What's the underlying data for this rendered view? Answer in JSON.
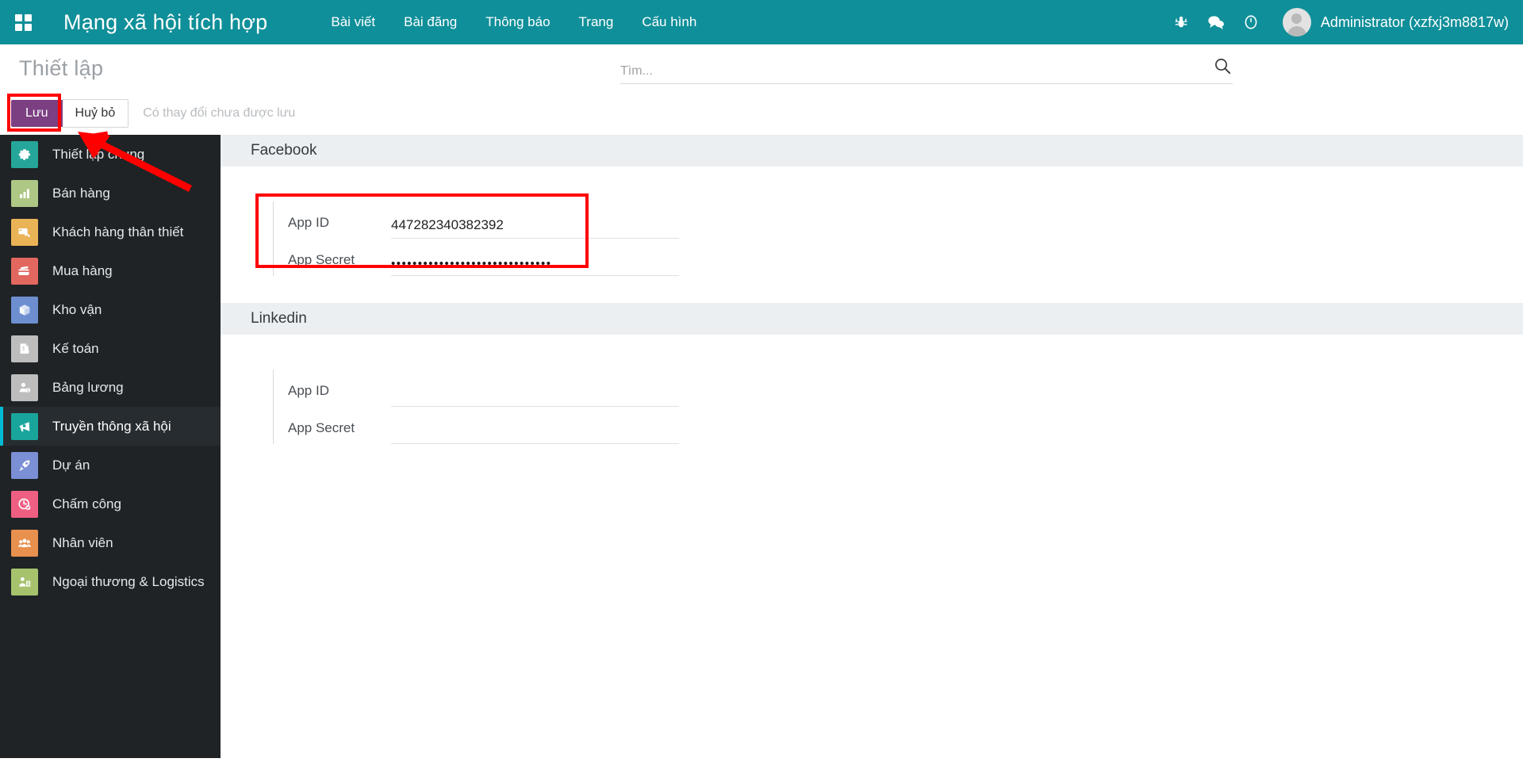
{
  "header": {
    "apps_icon": "apps-grid-icon",
    "brand": "Mạng xã hội tích hợp",
    "nav": [
      {
        "label": "Bài viết",
        "name": "nav-bai-viet"
      },
      {
        "label": "Bài đăng",
        "name": "nav-bai-dang"
      },
      {
        "label": "Thông báo",
        "name": "nav-thong-bao"
      },
      {
        "label": "Trang",
        "name": "nav-trang"
      },
      {
        "label": "Cấu hình",
        "name": "nav-cau-hinh"
      }
    ],
    "icons": [
      "bug-icon",
      "chat-bubble-icon",
      "clock-icon"
    ],
    "user": "Administrator (xzfxj3m8817w)",
    "accent": "#0f8f99"
  },
  "subheader": {
    "title": "Thiết lập",
    "search_placeholder": "Tìm...",
    "search_value": "",
    "search_icon": "search-icon"
  },
  "toolbar": {
    "save_label": "Lưu",
    "cancel_label": "Huỷ bỏ",
    "dirty_message": "Có thay đổi chưa được lưu",
    "save_color": "#7b3f82",
    "highlight_color": "#ff0000"
  },
  "sidebar": {
    "items": [
      {
        "label": "Thiết lập chung",
        "icon": "gear-icon",
        "color": "#26a69a",
        "active": false
      },
      {
        "label": "Bán hàng",
        "icon": "bar-chart-icon",
        "color": "#aec785",
        "active": false
      },
      {
        "label": "Khách hàng thân thiết",
        "icon": "loyalty-card-icon",
        "color": "#eab356",
        "active": false
      },
      {
        "label": "Mua hàng",
        "icon": "credit-card-icon",
        "color": "#e2685f",
        "active": false
      },
      {
        "label": "Kho vận",
        "icon": "box-icon",
        "color": "#6d8fd0",
        "active": false
      },
      {
        "label": "Kế toán",
        "icon": "invoice-icon",
        "color": "#bdbdbd",
        "active": false
      },
      {
        "label": "Bảng lương",
        "icon": "payroll-person-icon",
        "color": "#bdbdbd",
        "active": false
      },
      {
        "label": "Truyền thông xã hội",
        "icon": "megaphone-icon",
        "color": "#1aa59c",
        "active": true
      },
      {
        "label": "Dự án",
        "icon": "rocket-icon",
        "color": "#7b8fd4",
        "active": false
      },
      {
        "label": "Chấm công",
        "icon": "clock-check-icon",
        "color": "#ef5f82",
        "active": false
      },
      {
        "label": "Nhân viên",
        "icon": "people-icon",
        "color": "#e8904e",
        "active": false
      },
      {
        "label": "Ngoại thương & Logistics",
        "icon": "worker-icon",
        "color": "#a6c26d",
        "active": false
      }
    ]
  },
  "main": {
    "sections": [
      {
        "title": "Facebook",
        "highlighted": true,
        "fields": [
          {
            "label": "App ID",
            "value": "447282340382392",
            "masked": false
          },
          {
            "label": "App Secret",
            "value": "••••••••••••••••••••••••••••••",
            "masked": true
          }
        ]
      },
      {
        "title": "Linkedin",
        "highlighted": false,
        "fields": [
          {
            "label": "App ID",
            "value": "",
            "masked": false
          },
          {
            "label": "App Secret",
            "value": "",
            "masked": true
          }
        ]
      }
    ]
  }
}
